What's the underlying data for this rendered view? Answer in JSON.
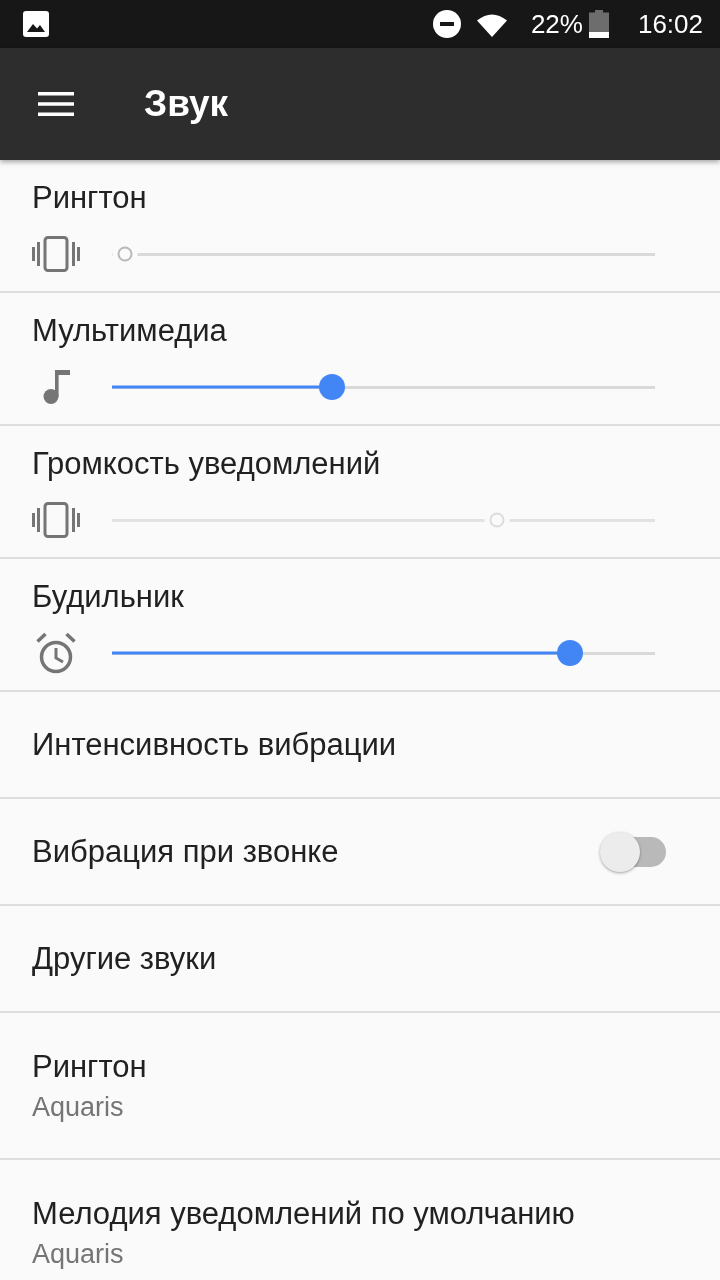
{
  "status_bar": {
    "battery_percent": "22%",
    "time": "16:02"
  },
  "app_bar": {
    "title": "Звук"
  },
  "settings": [
    {
      "kind": "slider",
      "title": "Рингтон",
      "level": 0,
      "disabled": false
    },
    {
      "kind": "slider",
      "title": "Мультимедиа",
      "level": 0.4,
      "disabled": false
    },
    {
      "kind": "slider",
      "title": "Громкость уведомлений",
      "level": 0.72,
      "disabled": true
    },
    {
      "kind": "slider",
      "title": "Будильник",
      "level": 0.86,
      "disabled": false
    },
    {
      "kind": "link",
      "title": "Интенсивность вибрации"
    },
    {
      "kind": "switch",
      "title": "Вибрация при звонке",
      "on": false
    },
    {
      "kind": "link",
      "title": "Другие звуки"
    },
    {
      "kind": "link",
      "title": "Рингтон",
      "summary": "Aquaris"
    },
    {
      "kind": "link",
      "title": "Мелодия уведомлений по умолчанию",
      "summary": "Aquaris"
    }
  ]
}
